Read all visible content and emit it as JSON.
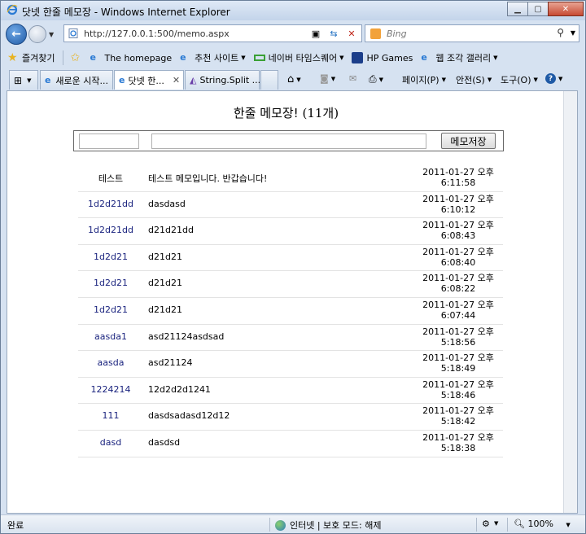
{
  "window": {
    "title": "닷넷 한줄 메모장 - Windows Internet Explorer"
  },
  "address_bar": {
    "url": "http://127.0.0.1:500/memo.aspx"
  },
  "search": {
    "placeholder": "Bing"
  },
  "favorites": {
    "label": "즐겨찾기",
    "items": [
      "The homepage",
      "추천 사이트",
      "네이버 타임스퀘어",
      "HP Games",
      "웹 조각 갤러리"
    ]
  },
  "tabs": [
    {
      "label": "새로운 시작..."
    },
    {
      "label": "닷넷 한..."
    },
    {
      "label": "String.Split ..."
    }
  ],
  "commands": {
    "page": "페이지(P)",
    "safety": "안전(S)",
    "tools": "도구(O)"
  },
  "page": {
    "title_text": "한줄 메모장!",
    "title_count": "(11개)",
    "save_label": "메모저장"
  },
  "memos": [
    {
      "name": "테스트",
      "message": "테스트 메모입니다. 반갑습니다!",
      "date": "2011-01-27 오후",
      "time": "6:11:58"
    },
    {
      "name": "1d2d21dd",
      "message": "dasdasd",
      "date": "2011-01-27 오후",
      "time": "6:10:12"
    },
    {
      "name": "1d2d21dd",
      "message": "d21d21dd",
      "date": "2011-01-27 오후",
      "time": "6:08:43"
    },
    {
      "name": "1d2d21",
      "message": "d21d21",
      "date": "2011-01-27 오후",
      "time": "6:08:40"
    },
    {
      "name": "1d2d21",
      "message": "d21d21",
      "date": "2011-01-27 오후",
      "time": "6:08:22"
    },
    {
      "name": "1d2d21",
      "message": "d21d21",
      "date": "2011-01-27 오후",
      "time": "6:07:44"
    },
    {
      "name": "aasda1",
      "message": "asd21124asdsad",
      "date": "2011-01-27 오후",
      "time": "5:18:56"
    },
    {
      "name": "aasda",
      "message": "asd21124",
      "date": "2011-01-27 오후",
      "time": "5:18:49"
    },
    {
      "name": "1224214",
      "message": "12d2d2d1241",
      "date": "2011-01-27 오후",
      "time": "5:18:46"
    },
    {
      "name": "111",
      "message": "dasdsadasd12d12",
      "date": "2011-01-27 오후",
      "time": "5:18:42"
    },
    {
      "name": "dasd",
      "message": "dasdsd",
      "date": "2011-01-27 오후",
      "time": "5:18:38"
    }
  ],
  "status": {
    "text": "완료",
    "zone": "인터넷 | 보호 모드: 해제",
    "zoom": "100%"
  }
}
